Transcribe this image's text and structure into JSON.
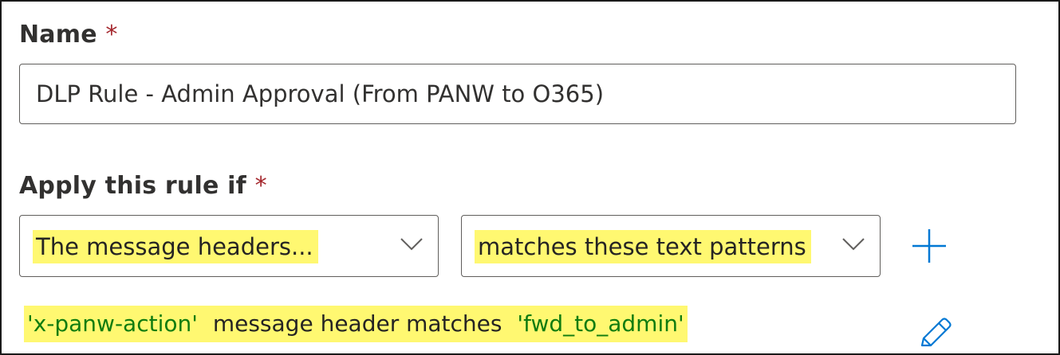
{
  "name_field": {
    "label": "Name",
    "required_mark": "*",
    "value": "DLP Rule - Admin Approval (From PANW to O365)"
  },
  "condition_section": {
    "label": "Apply this rule if",
    "required_mark": "*",
    "property_dropdown": {
      "selected": "The message headers..."
    },
    "operator_dropdown": {
      "selected": "matches these text patterns"
    },
    "add_icon": "plus-icon",
    "condition_summary": {
      "header_name": "'x-panw-action'",
      "connector": "message header matches",
      "pattern": "'fwd_to_admin'"
    },
    "edit_icon": "pencil-icon"
  },
  "colors": {
    "highlight": "#fff871",
    "required": "#a4262c",
    "value_green": "#107c10",
    "accent_blue": "#0078d4"
  }
}
